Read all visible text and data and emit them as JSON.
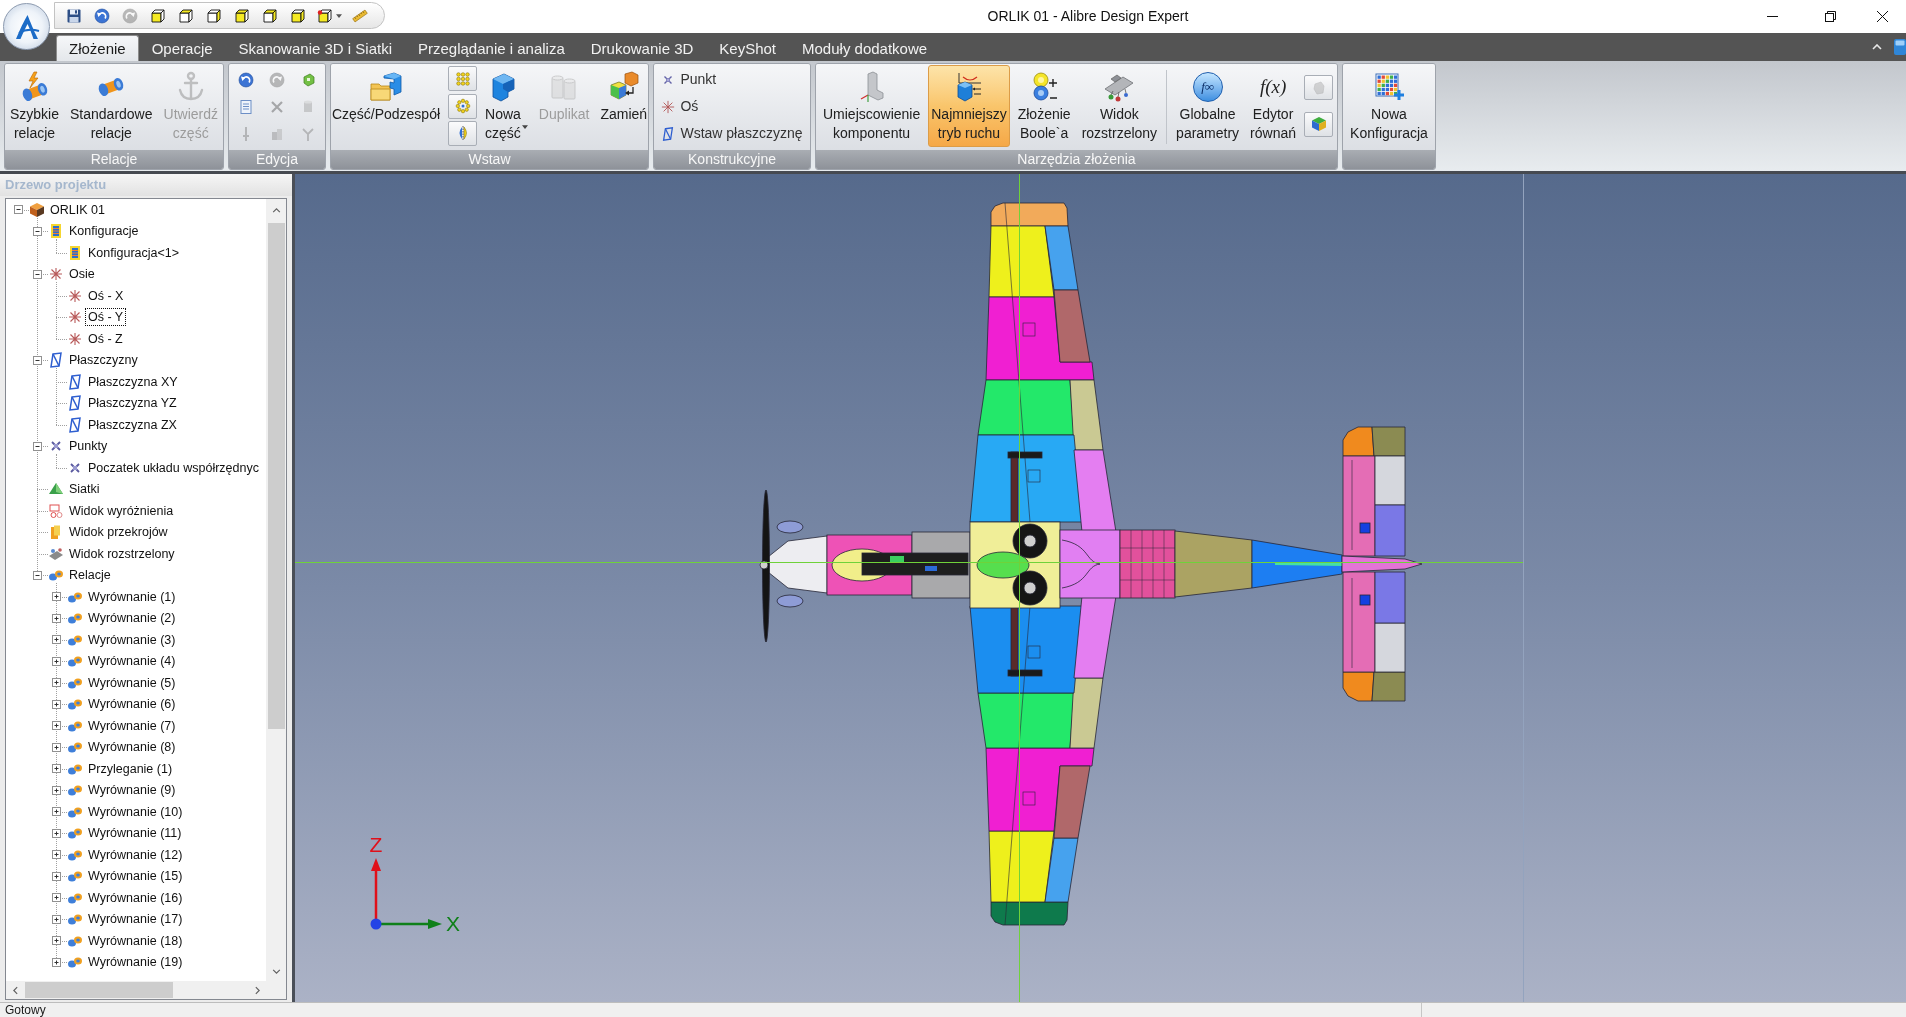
{
  "title_bar": {
    "quick_access": [
      {
        "kind": "save",
        "disabled": false
      },
      {
        "kind": "undo",
        "disabled": false
      },
      {
        "kind": "redo",
        "disabled": true
      },
      {
        "kind": "view",
        "disabled": false
      },
      {
        "kind": "view",
        "disabled": false
      },
      {
        "kind": "view",
        "disabled": false
      },
      {
        "kind": "view",
        "disabled": false
      },
      {
        "kind": "view",
        "disabled": false
      },
      {
        "kind": "view",
        "disabled": false
      },
      {
        "kind": "view-menu",
        "disabled": false
      },
      {
        "kind": "measure",
        "disabled": false
      }
    ],
    "title": "ORLIK 01 - Alibre Design Expert"
  },
  "ribbon": {
    "tabs": [
      {
        "label": "Złożenie",
        "selected": true
      },
      {
        "label": "Operacje",
        "selected": false
      },
      {
        "label": "Skanowanie 3D i Siatki",
        "selected": false
      },
      {
        "label": "Przeglądanie i analiza",
        "selected": false
      },
      {
        "label": "Drukowanie 3D",
        "selected": false
      },
      {
        "label": "KeyShot",
        "selected": false
      },
      {
        "label": "Moduły dodatkowe",
        "selected": false
      }
    ],
    "groups": [
      {
        "label": "Relacje",
        "items": [
          {
            "kind": "large",
            "label": "Szybkie relacje",
            "disabled": false,
            "active": false
          },
          {
            "kind": "large",
            "label": "Standardowe relacje",
            "disabled": false,
            "active": false
          },
          {
            "kind": "large",
            "label": "Utwierdź część",
            "disabled": true,
            "active": false
          }
        ]
      },
      {
        "label": "Edycja",
        "items": [
          {
            "kind": "tool",
            "disabled": false
          },
          {
            "kind": "tool",
            "disabled": true
          },
          {
            "kind": "tool",
            "disabled": false
          },
          {
            "kind": "tool",
            "disabled": false
          },
          {
            "kind": "tool",
            "disabled": true
          },
          {
            "kind": "tool",
            "disabled": true
          },
          {
            "kind": "tool",
            "disabled": true
          },
          {
            "kind": "tool",
            "disabled": true
          },
          {
            "kind": "tool",
            "disabled": true
          }
        ]
      },
      {
        "label": "Wstaw",
        "items": [
          {
            "kind": "large",
            "label": "Część/Podzespół",
            "disabled": false,
            "active": false
          },
          {
            "kind": "framed-tool",
            "disabled": false
          },
          {
            "kind": "framed-tool",
            "disabled": false
          },
          {
            "kind": "framed-tool",
            "disabled": false
          },
          {
            "kind": "large-menu",
            "label": "Nowa część",
            "disabled": false,
            "active": false
          },
          {
            "kind": "large",
            "label": "Duplikat",
            "disabled": true,
            "active": false
          },
          {
            "kind": "large",
            "label": "Zamień",
            "disabled": false,
            "active": false
          }
        ]
      },
      {
        "label": "Konstrukcyjne",
        "items": [
          {
            "kind": "row",
            "label": "Punkt",
            "disabled": false
          },
          {
            "kind": "row",
            "label": "Oś",
            "disabled": false
          },
          {
            "kind": "row",
            "label": "Wstaw płaszczyznę",
            "disabled": false
          }
        ]
      },
      {
        "label": "Narzędzia złożenia",
        "items": [
          {
            "kind": "large",
            "label": "Umiejscowienie komponentu",
            "disabled": false,
            "active": false
          },
          {
            "kind": "large",
            "label": "Najmniejszy tryb ruchu",
            "disabled": false,
            "active": true
          },
          {
            "kind": "large",
            "label": "Złożenie Boole`a",
            "disabled": false,
            "active": false
          },
          {
            "kind": "large",
            "label": "Widok rozstrzelony",
            "disabled": false,
            "active": false
          },
          {
            "kind": "separator"
          },
          {
            "kind": "large",
            "label": "Globalne parametry",
            "badge": "f∞",
            "disabled": false,
            "active": false
          },
          {
            "kind": "large",
            "label": "Edytor równań",
            "glyph": "f(x)",
            "disabled": false,
            "active": false
          },
          {
            "kind": "framed-tool",
            "disabled": true
          },
          {
            "kind": "framed-tool",
            "disabled": false
          }
        ]
      },
      {
        "items": [
          {
            "kind": "large",
            "label": "Nowa Konfiguracja",
            "disabled": false,
            "active": false
          }
        ]
      }
    ]
  },
  "project_panel": {
    "title": "Drzewo projektu",
    "tree": [
      {
        "label": "ORLIK 01",
        "kind": "assembly",
        "expanded": true,
        "focused": false,
        "children": [
          {
            "label": "Konfiguracje",
            "kind": "configuration",
            "expanded": true,
            "focused": false,
            "children": [
              {
                "label": "Konfiguracja<1>",
                "kind": "configuration",
                "focused": false
              }
            ]
          },
          {
            "label": "Osie",
            "kind": "axis",
            "expanded": true,
            "focused": false,
            "children": [
              {
                "label": "Oś - X",
                "kind": "axis",
                "focused": false
              },
              {
                "label": "Oś - Y",
                "kind": "axis",
                "focused": true
              },
              {
                "label": "Oś - Z",
                "kind": "axis",
                "focused": false
              }
            ]
          },
          {
            "label": "Płaszczyzny",
            "kind": "plane",
            "expanded": true,
            "focused": false,
            "children": [
              {
                "label": "Płaszczyzna XY",
                "kind": "plane",
                "focused": false
              },
              {
                "label": "Płaszczyzna YZ",
                "kind": "plane",
                "focused": false
              },
              {
                "label": "Płaszczyzna ZX",
                "kind": "plane",
                "focused": false
              }
            ]
          },
          {
            "label": "Punkty",
            "kind": "point",
            "expanded": true,
            "focused": false,
            "children": [
              {
                "label": "Poczatek układu współrzędnyc",
                "kind": "point",
                "focused": false
              }
            ]
          },
          {
            "label": "Siatki",
            "kind": "mesh",
            "focused": false
          },
          {
            "label": "Widok wyróżnienia",
            "kind": "highlight-view",
            "focused": false
          },
          {
            "label": "Widok przekrojów",
            "kind": "section-view",
            "focused": false
          },
          {
            "label": "Widok rozstrzelony",
            "kind": "exploded-view",
            "focused": false
          },
          {
            "label": "Relacje",
            "kind": "constraint",
            "expanded": true,
            "focused": false,
            "children": [
              {
                "label": "Wyrównanie (1)",
                "kind": "constraint",
                "expanded": false,
                "focused": false
              },
              {
                "label": "Wyrównanie (2)",
                "kind": "constraint",
                "expanded": false,
                "focused": false
              },
              {
                "label": "Wyrównanie (3)",
                "kind": "constraint",
                "expanded": false,
                "focused": false
              },
              {
                "label": "Wyrównanie (4)",
                "kind": "constraint",
                "expanded": false,
                "focused": false
              },
              {
                "label": "Wyrównanie (5)",
                "kind": "constraint",
                "expanded": false,
                "focused": false
              },
              {
                "label": "Wyrównanie (6)",
                "kind": "constraint",
                "expanded": false,
                "focused": false
              },
              {
                "label": "Wyrównanie (7)",
                "kind": "constraint",
                "expanded": false,
                "focused": false
              },
              {
                "label": "Wyrównanie (8)",
                "kind": "constraint",
                "expanded": false,
                "focused": false
              },
              {
                "label": "Przyleganie (1)",
                "kind": "constraint",
                "expanded": false,
                "focused": false
              },
              {
                "label": "Wyrównanie (9)",
                "kind": "constraint",
                "expanded": false,
                "focused": false
              },
              {
                "label": "Wyrównanie (10)",
                "kind": "constraint",
                "expanded": false,
                "focused": false
              },
              {
                "label": "Wyrównanie (11)",
                "kind": "constraint",
                "expanded": false,
                "focused": false
              },
              {
                "label": "Wyrównanie (12)",
                "kind": "constraint",
                "expanded": false,
                "focused": false
              },
              {
                "label": "Wyrównanie (15)",
                "kind": "constraint",
                "expanded": false,
                "focused": false
              },
              {
                "label": "Wyrównanie (16)",
                "kind": "constraint",
                "expanded": false,
                "focused": false
              },
              {
                "label": "Wyrównanie (17)",
                "kind": "constraint",
                "expanded": false,
                "focused": false
              },
              {
                "label": "Wyrównanie (18)",
                "kind": "constraint",
                "expanded": false,
                "focused": false
              },
              {
                "label": "Wyrównanie (19)",
                "kind": "constraint",
                "expanded": false,
                "focused": false
              }
            ]
          }
        ]
      }
    ]
  },
  "viewport": {
    "axis_triad": [
      {
        "kind": "vertical",
        "label": "Z",
        "color": "#e0101a"
      },
      {
        "kind": "horizontal",
        "label": "X",
        "color": "#0f8019"
      }
    ]
  },
  "status_bar": {
    "text": "Gotowy"
  }
}
